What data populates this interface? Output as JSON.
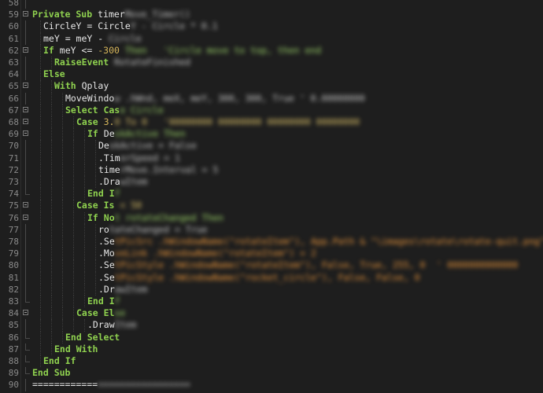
{
  "colors": {
    "background": "#1e1e1e",
    "keyword": "#8fd14f",
    "identifier": "#e6e6e6",
    "number": "#d4b45a",
    "string": "#e8943a",
    "line_number": "#8a8a8a"
  },
  "lines": [
    {
      "n": "58",
      "indent": 0,
      "fold": "line",
      "segs": []
    },
    {
      "n": "59",
      "indent": 0,
      "fold": "box",
      "segs": [
        {
          "t": "Private Sub ",
          "c": "kw"
        },
        {
          "t": "timer",
          "c": "id"
        },
        {
          "t": "Move_Timer()",
          "c": "id",
          "blur": true
        }
      ]
    },
    {
      "n": "60",
      "indent": 1,
      "fold": "line",
      "segs": [
        {
          "t": "CircleY = Circle",
          "c": "id"
        },
        {
          "t": "Y - Circle * 0.1",
          "c": "id",
          "blur": true
        }
      ]
    },
    {
      "n": "61",
      "indent": 1,
      "fold": "line",
      "segs": [
        {
          "t": "meY = meY - ",
          "c": "id"
        },
        {
          "t": "Circle",
          "c": "id",
          "blur": true
        }
      ]
    },
    {
      "n": "62",
      "indent": 1,
      "fold": "box",
      "segs": [
        {
          "t": "If ",
          "c": "kw"
        },
        {
          "t": "meY <= ",
          "c": "id"
        },
        {
          "t": "-300",
          "c": "num"
        },
        {
          "t": " Then   'Circle move to top, then end",
          "c": "kw",
          "blur": true
        }
      ]
    },
    {
      "n": "63",
      "indent": 2,
      "fold": "line",
      "segs": [
        {
          "t": "RaiseEvent ",
          "c": "kw"
        },
        {
          "t": "RotateFinished",
          "c": "id",
          "blur": true
        }
      ]
    },
    {
      "n": "64",
      "indent": 1,
      "fold": "line",
      "segs": [
        {
          "t": "Else",
          "c": "kw"
        }
      ]
    },
    {
      "n": "65",
      "indent": 2,
      "fold": "box",
      "segs": [
        {
          "t": "With ",
          "c": "kw"
        },
        {
          "t": "Qplay",
          "c": "id"
        }
      ]
    },
    {
      "n": "66",
      "indent": 3,
      "fold": "line",
      "segs": [
        {
          "t": "MoveWindo",
          "c": "id"
        },
        {
          "t": "w .hWnd, meX, meY, 300, 300, True ' 0.00000000",
          "c": "id",
          "blur": true
        }
      ]
    },
    {
      "n": "67",
      "indent": 3,
      "fold": "box",
      "segs": [
        {
          "t": "Select Cas",
          "c": "kw"
        },
        {
          "t": "e Circle",
          "c": "kw",
          "blur": true
        }
      ]
    },
    {
      "n": "68",
      "indent": 4,
      "fold": "box",
      "segs": [
        {
          "t": "Case ",
          "c": "kw"
        },
        {
          "t": "3.",
          "c": "num"
        },
        {
          "t": "0 To 0   '00000000 00000000 00000000 00000000",
          "c": "num",
          "blur": true
        }
      ]
    },
    {
      "n": "69",
      "indent": 5,
      "fold": "box",
      "segs": [
        {
          "t": "If ",
          "c": "kw"
        },
        {
          "t": "De",
          "c": "id"
        },
        {
          "t": "skActive Then",
          "c": "kw",
          "blur": true
        }
      ]
    },
    {
      "n": "70",
      "indent": 6,
      "fold": "line",
      "segs": [
        {
          "t": "De",
          "c": "id"
        },
        {
          "t": "skActive = False",
          "c": "id",
          "blur": true
        }
      ]
    },
    {
      "n": "71",
      "indent": 6,
      "fold": "line",
      "segs": [
        {
          "t": ".Tim",
          "c": "id"
        },
        {
          "t": "erSpeed = 1",
          "c": "id",
          "blur": true
        }
      ]
    },
    {
      "n": "72",
      "indent": 6,
      "fold": "line",
      "segs": [
        {
          "t": "time",
          "c": "id"
        },
        {
          "t": "rMove.Interval = 5",
          "c": "id",
          "blur": true
        }
      ]
    },
    {
      "n": "73",
      "indent": 6,
      "fold": "line",
      "segs": [
        {
          "t": ".Dra",
          "c": "id"
        },
        {
          "t": "wItem",
          "c": "id",
          "blur": true
        }
      ]
    },
    {
      "n": "74",
      "indent": 5,
      "fold": "end",
      "segs": [
        {
          "t": "End I",
          "c": "kw"
        },
        {
          "t": "f",
          "c": "kw",
          "blur": true
        }
      ]
    },
    {
      "n": "75",
      "indent": 4,
      "fold": "box",
      "segs": [
        {
          "t": "Case Is ",
          "c": "kw"
        },
        {
          "t": "< 50",
          "c": "num",
          "blur": true
        }
      ]
    },
    {
      "n": "76",
      "indent": 5,
      "fold": "box",
      "segs": [
        {
          "t": "If No",
          "c": "kw"
        },
        {
          "t": "t rotateChanged Then",
          "c": "kw",
          "blur": true
        }
      ]
    },
    {
      "n": "77",
      "indent": 6,
      "fold": "line",
      "segs": [
        {
          "t": "ro",
          "c": "id"
        },
        {
          "t": "tateChanged = True",
          "c": "id",
          "blur": true
        }
      ]
    },
    {
      "n": "78",
      "indent": 6,
      "fold": "line",
      "segs": [
        {
          "t": ".Se",
          "c": "id"
        },
        {
          "t": "tPicSrc .hWindowName(\"rotateItem\"), App.Path & \"\\images\\rotate\\rotate-quit.png\"",
          "c": "str",
          "blur": true
        }
      ]
    },
    {
      "n": "79",
      "indent": 6,
      "fold": "line",
      "segs": [
        {
          "t": ".Mo",
          "c": "id"
        },
        {
          "t": "veLink .hWindowName(\"rotateItem\") + 2",
          "c": "str",
          "blur": true
        }
      ]
    },
    {
      "n": "80",
      "indent": 6,
      "fold": "line",
      "segs": [
        {
          "t": ".Se",
          "c": "id"
        },
        {
          "t": "tPicStyle .hWindowName(\"rotateItem\"), False, True, 255, 0  ' 0000000000000",
          "c": "str",
          "blur": true
        }
      ]
    },
    {
      "n": "81",
      "indent": 6,
      "fold": "line",
      "segs": [
        {
          "t": ".Se",
          "c": "id"
        },
        {
          "t": "tPicStyle .hWindowName(\"rocket_circle\"), False, False, 0",
          "c": "str",
          "blur": true
        }
      ]
    },
    {
      "n": "82",
      "indent": 6,
      "fold": "line",
      "segs": [
        {
          "t": ".Dr",
          "c": "id"
        },
        {
          "t": "awItem",
          "c": "id",
          "blur": true
        }
      ]
    },
    {
      "n": "83",
      "indent": 5,
      "fold": "end",
      "segs": [
        {
          "t": "End I",
          "c": "kw"
        },
        {
          "t": "f",
          "c": "kw",
          "blur": true
        }
      ]
    },
    {
      "n": "84",
      "indent": 4,
      "fold": "box",
      "segs": [
        {
          "t": "Case El",
          "c": "kw"
        },
        {
          "t": "se",
          "c": "kw",
          "blur": true
        }
      ]
    },
    {
      "n": "85",
      "indent": 5,
      "fold": "line",
      "segs": [
        {
          "t": ".Draw",
          "c": "id"
        },
        {
          "t": "Item",
          "c": "id",
          "blur": true
        }
      ]
    },
    {
      "n": "86",
      "indent": 3,
      "fold": "end",
      "segs": [
        {
          "t": "End Select",
          "c": "kw"
        }
      ]
    },
    {
      "n": "87",
      "indent": 2,
      "fold": "end",
      "segs": [
        {
          "t": "End With",
          "c": "kw"
        }
      ]
    },
    {
      "n": "88",
      "indent": 1,
      "fold": "end",
      "segs": [
        {
          "t": "End If",
          "c": "kw"
        }
      ]
    },
    {
      "n": "89",
      "indent": 0,
      "fold": "end",
      "segs": [
        {
          "t": "End Sub",
          "c": "kw"
        }
      ]
    },
    {
      "n": "90",
      "indent": 0,
      "fold": "line",
      "segs": [
        {
          "t": "============",
          "c": "id"
        },
        {
          "t": "=================",
          "c": "id",
          "blur": true
        }
      ]
    }
  ]
}
